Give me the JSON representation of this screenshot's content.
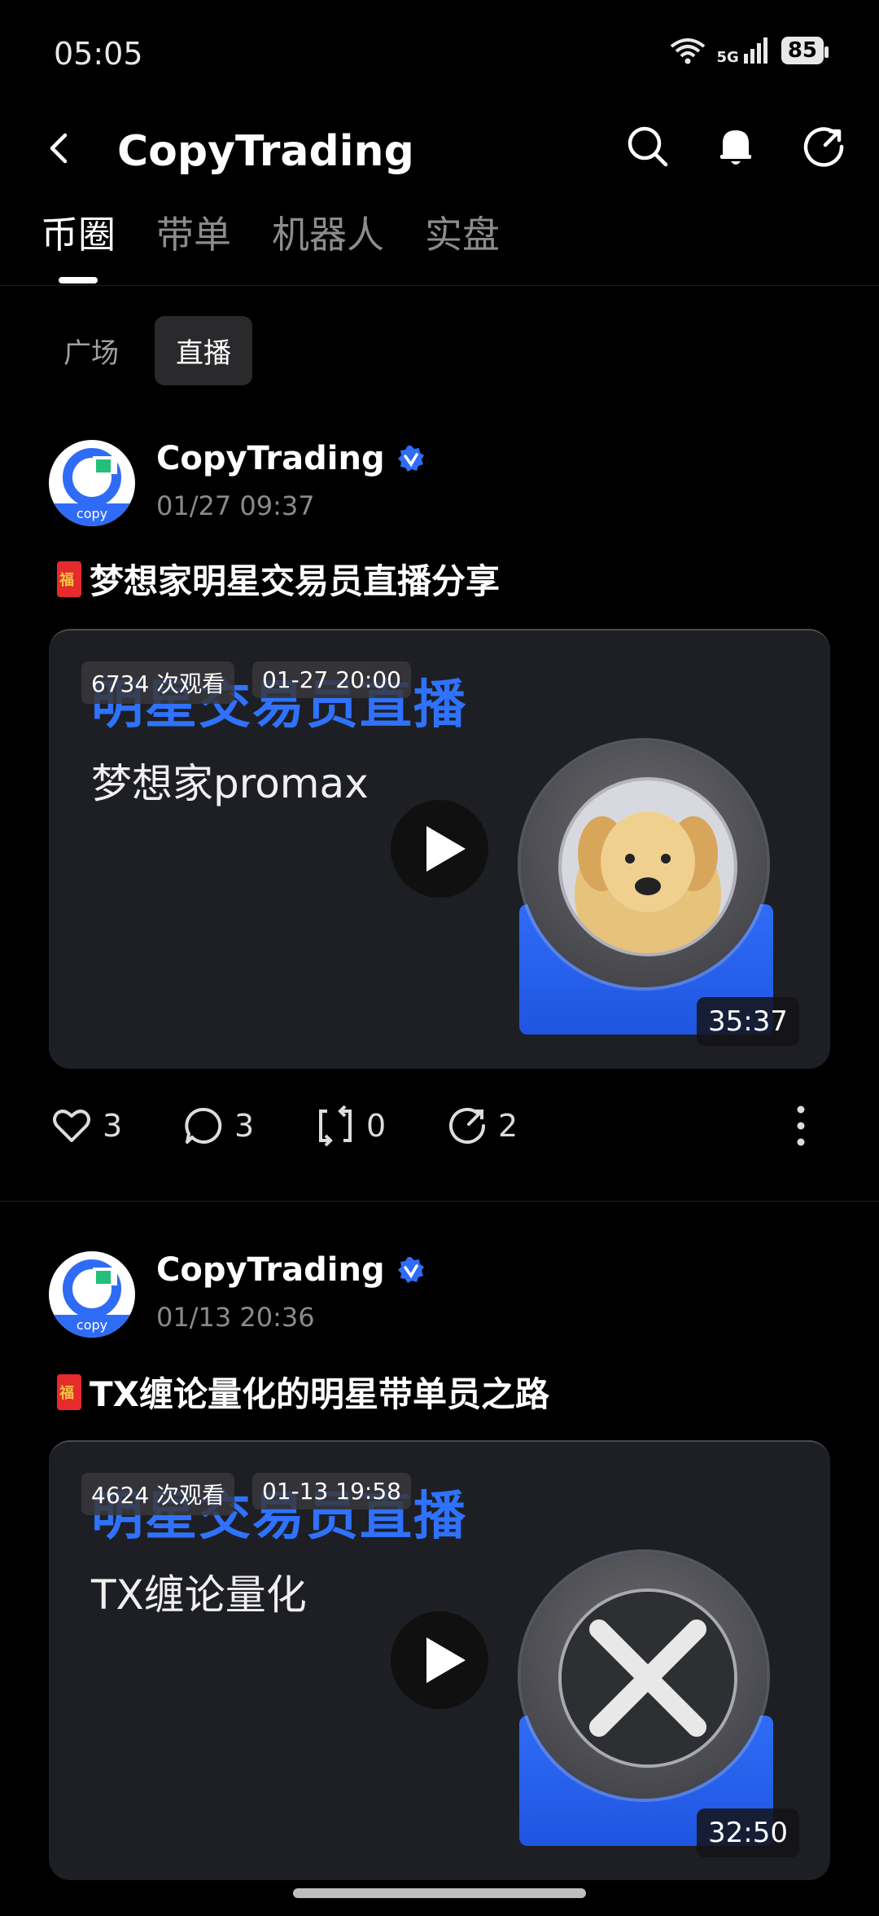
{
  "status_bar": {
    "time": "05:05",
    "network": "5G",
    "battery": "85"
  },
  "header": {
    "title": "CopyTrading"
  },
  "tabs": [
    {
      "label": "币圈",
      "active": true
    },
    {
      "label": "带单",
      "active": false
    },
    {
      "label": "机器人",
      "active": false
    },
    {
      "label": "实盘",
      "active": false
    }
  ],
  "subtabs": [
    {
      "label": "广场",
      "active": false
    },
    {
      "label": "直播",
      "active": true
    }
  ],
  "posts": [
    {
      "author": "CopyTrading",
      "avatar_tag": "copy",
      "time": "01/27 09:37",
      "title": "梦想家明星交易员直播分享",
      "video": {
        "views": "6734 次观看",
        "date": "01-27 20:00",
        "headline": "明星交易员直播",
        "subtitle": "梦想家promax",
        "duration": "35:37"
      },
      "likes": "3",
      "comments": "3",
      "reposts": "0",
      "shares": "2"
    },
    {
      "author": "CopyTrading",
      "avatar_tag": "copy",
      "time": "01/13 20:36",
      "title": "TX缠论量化的明星带单员之路",
      "video": {
        "views": "4624 次观看",
        "date": "01-13 19:58",
        "headline": "明星交易员直播",
        "subtitle": "TX缠论量化",
        "duration": "32:50"
      }
    }
  ]
}
